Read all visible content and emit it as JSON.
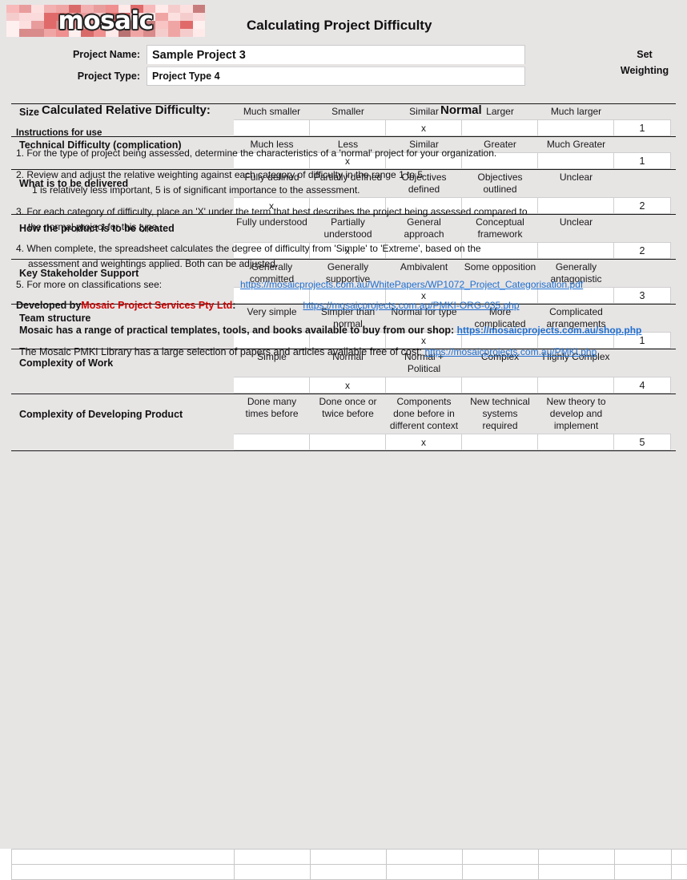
{
  "header": {
    "logo_text": "mosaic",
    "title": "Calculating Project Difficulty",
    "project_name_label": "Project Name:",
    "project_name_value": "Sample Project 3",
    "project_type_label": "Project Type:",
    "project_type_value": "Project Type 4",
    "set_weighting_line1": "Set",
    "set_weighting_line2": "Weighting"
  },
  "matrix": {
    "rows": [
      {
        "label": "Size",
        "options": [
          "Much smaller",
          "Smaller",
          "Similar",
          "Larger",
          "Much larger"
        ],
        "marks": [
          "",
          "",
          "x",
          "",
          ""
        ],
        "weighting": "1"
      },
      {
        "label": "Technical Difficulty (complication)",
        "options": [
          "Much less",
          "Less",
          "Similar",
          "Greater",
          "Much Greater"
        ],
        "marks": [
          "",
          "x",
          "",
          "",
          ""
        ],
        "weighting": "1"
      },
      {
        "label": "What is to be delivered",
        "options": [
          "Fully defined",
          "Partially defined",
          "Objectives defined",
          "Objectives outlined",
          "Unclear"
        ],
        "marks": [
          "x",
          "",
          "",
          "",
          ""
        ],
        "weighting": "2"
      },
      {
        "label": "How the product is to be created",
        "options": [
          "Fully understood",
          "Partially understood",
          "General approach",
          "Conceptual framework",
          "Unclear"
        ],
        "marks": [
          "",
          "x",
          "",
          "",
          ""
        ],
        "weighting": "2"
      },
      {
        "label": "Key Stakeholder Support",
        "options": [
          "Generally committed",
          "Generally supportive",
          "Ambivalent",
          "Some opposition",
          "Generally antagonistic"
        ],
        "marks": [
          "",
          "",
          "x",
          "",
          ""
        ],
        "weighting": "3"
      },
      {
        "label": "Team structure",
        "options": [
          "Very simple",
          "Simpler than normal",
          "Normal for type",
          "More complicated",
          "Complicated arrangements"
        ],
        "marks": [
          "",
          "",
          "x",
          "",
          ""
        ],
        "weighting": "1"
      },
      {
        "label": "Complexity of Work",
        "options": [
          "Simple",
          "Normal",
          "Normal + Political",
          "Complex",
          "Highly Complex"
        ],
        "marks": [
          "",
          "x",
          "",
          "",
          ""
        ],
        "weighting": "4"
      },
      {
        "label": "Complexity of Developing Product",
        "options": [
          "Done many times before",
          "Done once or twice before",
          "Components done before in different context",
          "New technical systems required",
          "New theory to develop and implement"
        ],
        "marks": [
          "",
          "",
          "x",
          "",
          ""
        ],
        "weighting": "5"
      }
    ]
  },
  "result": {
    "label": "Calculated Relative Difficulty:",
    "value": "Normal"
  },
  "instructions": {
    "heading": "Instructions for use",
    "item1": "1.  For the type of project being assessed, determine the characteristics of a 'normal' project for your organization.",
    "item2": "2. Review and adjust the relative weighting against each category of difficulty in the range 1 to 5",
    "item2b": "1 is relatively less important, 5 is of significant importance to the assessment.",
    "item3": "3. For each category of difficulty, place an 'X' under the term that best describes the project being assessed compared to",
    "item3b": "the normal project for this type.",
    "item4": "4. When complete, the spreadsheet calculates the  degree of difficulty from 'Simple' to 'Extreme', based on the",
    "item4b": "assessment and weightings applied.  Both can be adjusted.",
    "item5_label": "5.  For more  on classifications see:",
    "item5_link": "https://mosaicprojects.com.au/WhitePapers/WP1072_Project_Categorisation.pdf"
  },
  "footer": {
    "developed_prefix": "Developed by ",
    "developed_company": "Mosaic Project Services Pty Ltd",
    "developed_suffix": ":",
    "developed_link": "https://mosaicprojects.com.au/PMKI-ORG-035.php",
    "shop_text": "Mosaic has a range of practical templates, tools, and books available to buy from our shop: ",
    "shop_link": "https://mosaicprojects.com.au/shop.php",
    "library_text": "The Mosaic PMKI Library has a large selection of papers and articles available free of cost:  ",
    "library_link": "https://mosaicprojects.com.au/PMKI.php"
  },
  "colors": {
    "background": "#E7E4E4",
    "link": "#1F6FD0",
    "brand_red": "#CC0000",
    "cell_white": "#FFFFFF"
  }
}
